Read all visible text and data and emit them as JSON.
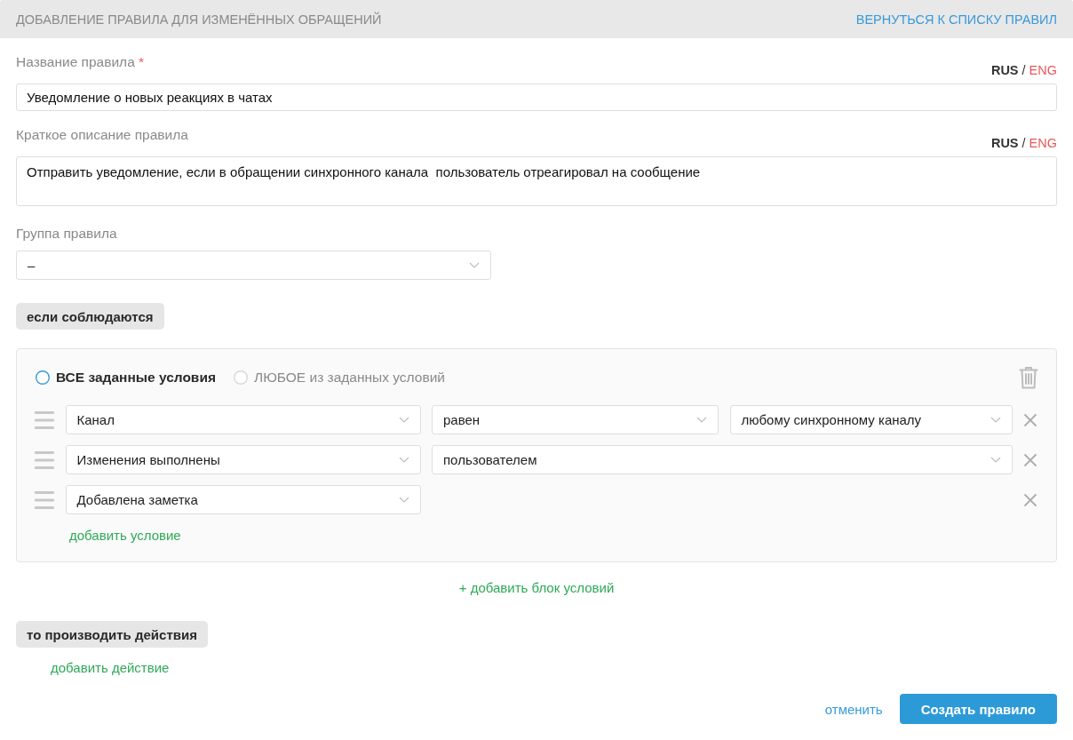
{
  "header": {
    "title": "ДОБАВЛЕНИЕ ПРАВИЛА ДЛЯ ИЗМЕНЁННЫХ ОБРАЩЕНИЙ",
    "back_link": "ВЕРНУТЬСЯ К СПИСКУ ПРАВИЛ"
  },
  "fields": [
    {
      "kind": "text",
      "label": "Название правила",
      "required_mark": "*",
      "language_separator": "/",
      "languages": [
        {
          "code": "RUS",
          "selected": true
        },
        {
          "code": "ENG",
          "selected": false
        }
      ],
      "value": "Уведомление о новых реакциях в чатах"
    },
    {
      "kind": "textarea",
      "label": "Краткое описание правила",
      "language_separator": "/",
      "languages": [
        {
          "code": "RUS",
          "selected": true
        },
        {
          "code": "ENG",
          "selected": false
        }
      ],
      "value": "Отправить уведомление, если в обращении синхронного канала  пользователь отреагировал на сообщение"
    },
    {
      "kind": "select",
      "label": "Группа правила",
      "value": "–"
    }
  ],
  "conditions_heading": "если соблюдаются",
  "condition_blocks": [
    {
      "match_options": [
        {
          "label": "ВСЕ заданные условия",
          "selected": true
        },
        {
          "label": "ЛЮБОЕ из заданных условий",
          "selected": false
        }
      ],
      "rows": [
        {
          "selects": [
            "Канал",
            "равен",
            "любому синхронному каналу"
          ]
        },
        {
          "selects": [
            "Изменения выполнены",
            "пользователем"
          ]
        },
        {
          "selects": [
            "Добавлена заметка"
          ]
        }
      ],
      "add_condition_link": "добавить условие"
    }
  ],
  "add_block_link": "+ добавить блок условий",
  "actions_heading": "то производить действия",
  "add_action_link": "добавить действие",
  "footer": [
    {
      "kind": "link",
      "label": "отменить"
    },
    {
      "kind": "primary",
      "label": "Создать правило"
    }
  ]
}
